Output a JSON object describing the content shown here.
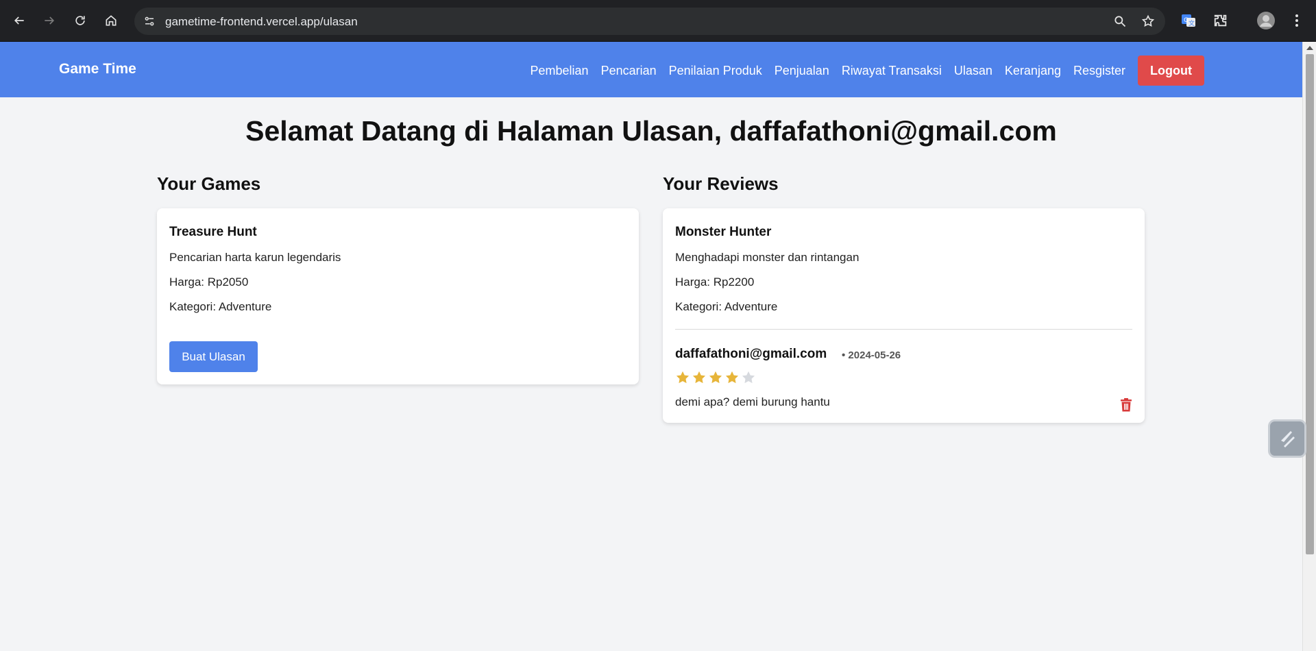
{
  "browser": {
    "url": "gametime-frontend.vercel.app/ulasan"
  },
  "navbar": {
    "brand": "Game Time",
    "links": [
      "Pembelian",
      "Pencarian",
      "Penilaian Produk",
      "Penjualan",
      "Riwayat Transaksi",
      "Ulasan",
      "Keranjang",
      "Resgister"
    ],
    "logout": "Logout",
    "colors": {
      "navbar": "#4f82ea",
      "logout": "#e04a4a"
    }
  },
  "page": {
    "title": "Selamat Datang di Halaman Ulasan, daffafathoni@gmail.com"
  },
  "games": {
    "heading": "Your Games",
    "card": {
      "name": "Treasure Hunt",
      "description": "Pencarian harta karun legendaris",
      "price": "Harga: Rp2050",
      "category": "Kategori: Adventure",
      "button": "Buat Ulasan"
    }
  },
  "reviews": {
    "heading": "Your Reviews",
    "card": {
      "name": "Monster Hunter",
      "description": "Menghadapi monster dan rintangan",
      "price": "Harga: Rp2200",
      "category": "Kategori: Adventure",
      "reviewer": "daffafathoni@gmail.com",
      "date": "• 2024-05-26",
      "rating": 4,
      "rating_max": 5,
      "text": "demi apa? demi burung hantu"
    }
  }
}
